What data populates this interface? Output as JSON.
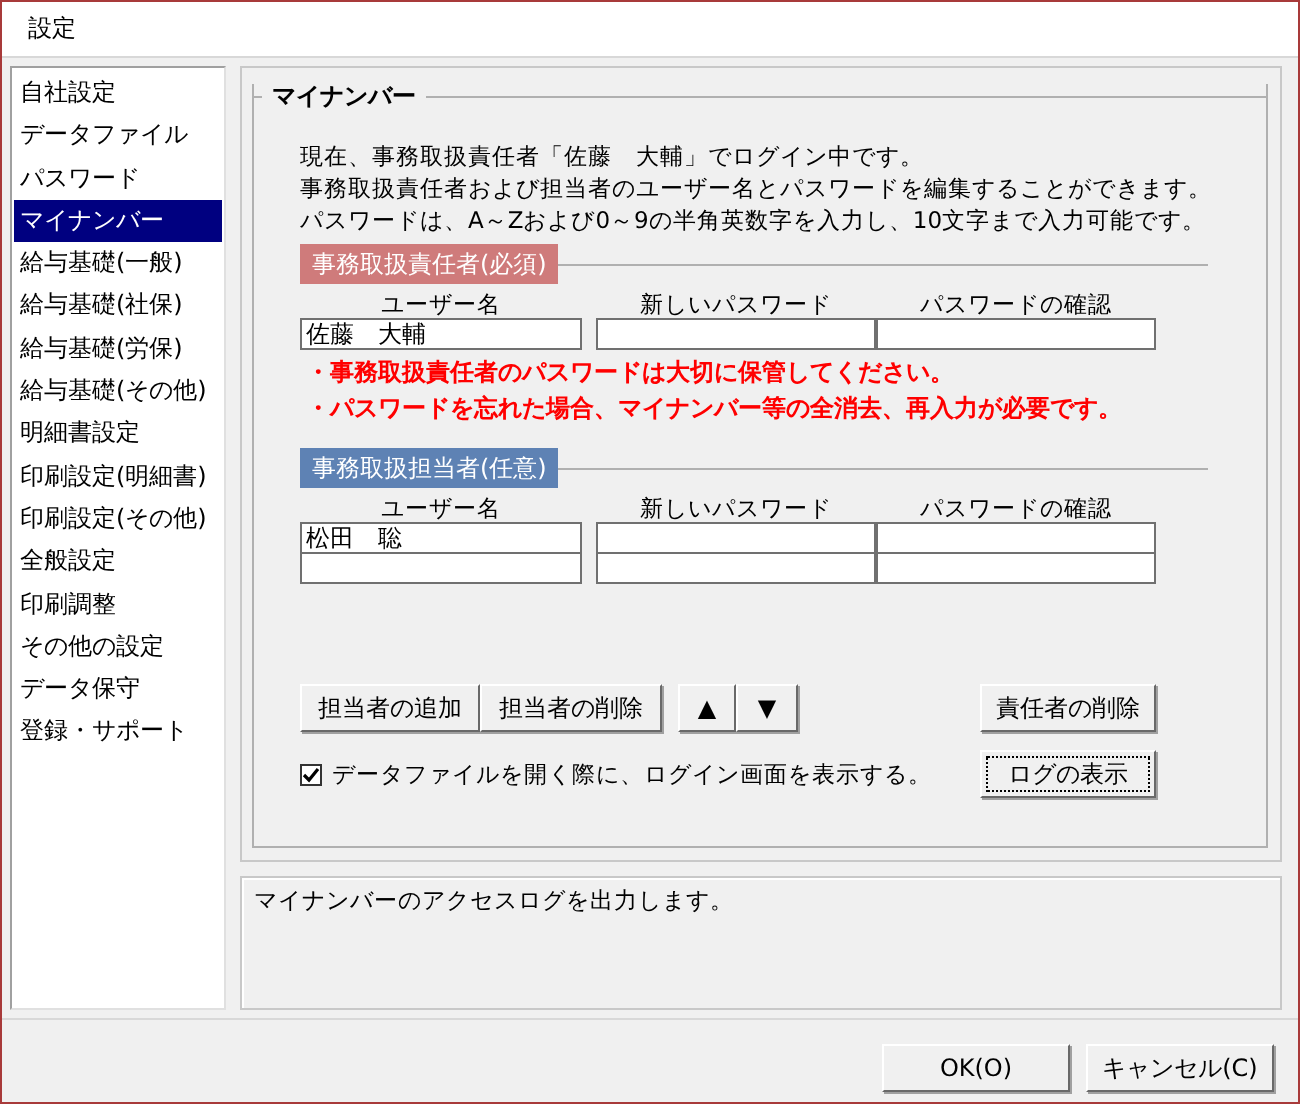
{
  "window": {
    "title": "設定"
  },
  "sidebar": {
    "items": [
      {
        "label": "自社設定",
        "selected": false
      },
      {
        "label": "データファイル",
        "selected": false
      },
      {
        "label": "パスワード",
        "selected": false
      },
      {
        "label": "マイナンバー",
        "selected": true
      },
      {
        "label": "給与基礎(一般)",
        "selected": false
      },
      {
        "label": "給与基礎(社保)",
        "selected": false
      },
      {
        "label": "給与基礎(労保)",
        "selected": false
      },
      {
        "label": "給与基礎(その他)",
        "selected": false
      },
      {
        "label": "明細書設定",
        "selected": false
      },
      {
        "label": "印刷設定(明細書)",
        "selected": false
      },
      {
        "label": "印刷設定(その他)",
        "selected": false
      },
      {
        "label": "全般設定",
        "selected": false
      },
      {
        "label": "印刷調整",
        "selected": false
      },
      {
        "label": "その他の設定",
        "selected": false
      },
      {
        "label": "データ保守",
        "selected": false
      },
      {
        "label": "登録・サポート",
        "selected": false
      }
    ]
  },
  "section": {
    "title": "マイナンバー",
    "intro": [
      "現在、事務取扱責任者「佐藤　大輔」でログイン中です。",
      "事務取扱責任者および担当者のユーザー名とパスワードを編集することができます。",
      "パスワードは、A～Zおよび0～9の半角英数字を入力し、10文字まで入力可能です。"
    ],
    "responsible": {
      "title": "事務取扱責任者(必須)",
      "columns": [
        "ユーザー名",
        "新しいパスワード",
        "パスワードの確認"
      ],
      "rows": [
        {
          "user_name": "佐藤　大輔"
        }
      ]
    },
    "warnings": [
      "・事務取扱責任者のパスワードは大切に保管してください。",
      "・パスワードを忘れた場合、マイナンバー等の全消去、再入力が必要です。"
    ],
    "staff": {
      "title": "事務取扱担当者(任意)",
      "columns": [
        "ユーザー名",
        "新しいパスワード",
        "パスワードの確認"
      ],
      "rows": [
        {
          "user_name": "松田　聡"
        },
        {}
      ]
    },
    "staff_buttons": [
      "担当者の追加",
      "担当者の削除"
    ],
    "move_buttons": [
      "▲",
      "▼"
    ],
    "delete_responsible": "責任者の削除",
    "show_login": {
      "label": "データファイルを開く際に、ログイン画面を表示する。",
      "checked": true
    },
    "log_button": {
      "label": "ログの表示",
      "focused": true
    }
  },
  "description": "マイナンバーのアクセスログを出力します。",
  "footer_buttons": [
    "OK(O)",
    "キャンセル(C)"
  ]
}
